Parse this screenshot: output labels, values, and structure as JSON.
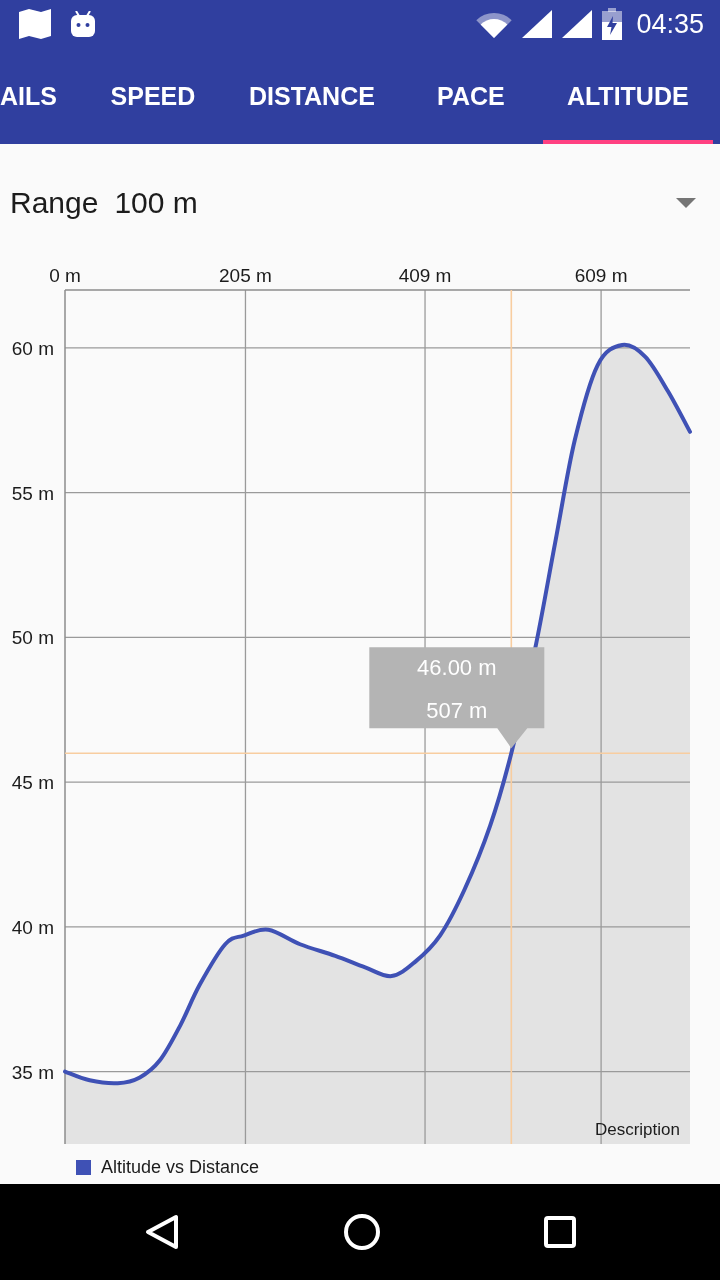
{
  "status_bar": {
    "time": "04:35"
  },
  "tabs": [
    {
      "label": "AILS",
      "selected": false
    },
    {
      "label": "SPEED",
      "selected": false
    },
    {
      "label": "DISTANCE",
      "selected": false
    },
    {
      "label": "PACE",
      "selected": false
    },
    {
      "label": "ALTITUDE",
      "selected": true
    }
  ],
  "range": {
    "label": "Range",
    "value": "100 m"
  },
  "chart": {
    "chart_data": {
      "type": "area",
      "x": [
        0,
        28,
        60,
        85,
        108,
        131,
        153,
        182,
        203,
        231,
        267,
        307,
        341,
        371,
        398,
        426,
        454,
        483,
        507,
        534,
        557,
        579,
        605,
        633,
        659,
        685,
        710
      ],
      "series": [
        {
          "name": "Altitude vs Distance",
          "color": "#3f51b5",
          "values": [
            35.0,
            34.7,
            34.6,
            34.8,
            35.4,
            36.6,
            38.0,
            39.4,
            39.7,
            39.9,
            39.4,
            39.0,
            38.6,
            38.3,
            38.8,
            39.7,
            41.3,
            43.5,
            46.0,
            49.6,
            53.3,
            56.8,
            59.4,
            60.1,
            59.7,
            58.5,
            57.1
          ]
        }
      ],
      "xlim": [
        0,
        710
      ],
      "ylim": [
        32.5,
        62
      ],
      "xticks": [
        {
          "value": 0,
          "label": "0 m"
        },
        {
          "value": 205,
          "label": "205 m"
        },
        {
          "value": 409,
          "label": "409 m"
        },
        {
          "value": 609,
          "label": "609 m"
        }
      ],
      "yticks": [
        {
          "value": 35,
          "label": "35 m"
        },
        {
          "value": 40,
          "label": "40 m"
        },
        {
          "value": 45,
          "label": "45 m"
        },
        {
          "value": 50,
          "label": "50 m"
        },
        {
          "value": 55,
          "label": "55 m"
        },
        {
          "value": 60,
          "label": "60 m"
        }
      ],
      "grid": true,
      "ref_lines": [
        {
          "axis": "x",
          "value": 507,
          "color": "#f8cda0"
        },
        {
          "axis": "y",
          "value": 46,
          "color": "#f8cda0"
        }
      ]
    },
    "marker": {
      "lines": [
        "46.00 m",
        "507 m"
      ]
    },
    "description": "Description"
  }
}
